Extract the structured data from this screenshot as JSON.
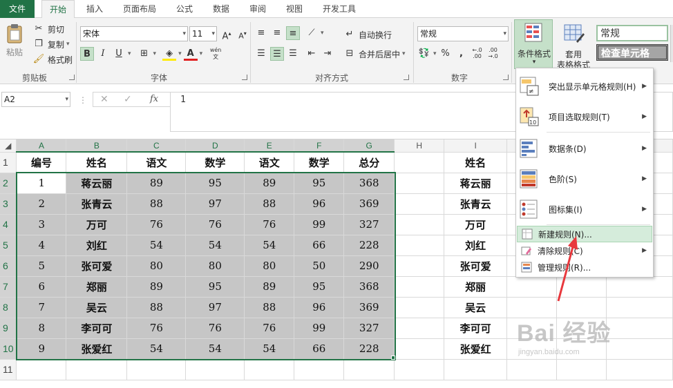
{
  "tabs": [
    "文件",
    "开始",
    "插入",
    "页面布局",
    "公式",
    "数据",
    "审阅",
    "视图",
    "开发工具"
  ],
  "ribbon": {
    "clipboard": {
      "paste": "粘贴",
      "cut": "剪切",
      "copy": "复制",
      "format_painter": "格式刷",
      "group": "剪贴板"
    },
    "font": {
      "name": "宋体",
      "size": "11",
      "bold": "B",
      "italic": "I",
      "underline": "U",
      "phonetic": "wén",
      "group": "字体"
    },
    "alignment": {
      "wrap": "自动换行",
      "merge": "合并后居中",
      "group": "对齐方式"
    },
    "number": {
      "format": "常规",
      "percent": "%",
      "comma": ",",
      "group": "数字"
    },
    "styles": {
      "conditional": "条件格式",
      "table_format_1": "套用",
      "table_format_2": "表格格式",
      "style_normal": "常规",
      "style_check": "检查单元格"
    }
  },
  "formula_bar": {
    "name_box": "A2",
    "fx": "fx",
    "content": "1"
  },
  "columns": [
    "A",
    "B",
    "C",
    "D",
    "E",
    "F",
    "G",
    "H",
    "I"
  ],
  "rows": [
    {
      "n": "1",
      "cells": [
        "编号",
        "姓名",
        "语文",
        "数学",
        "语文",
        "数学",
        "总分",
        "",
        "姓名"
      ]
    },
    {
      "n": "2",
      "cells": [
        "1",
        "蒋云丽",
        "89",
        "95",
        "89",
        "95",
        "368",
        "",
        "蒋云丽"
      ]
    },
    {
      "n": "3",
      "cells": [
        "2",
        "张青云",
        "88",
        "97",
        "88",
        "96",
        "369",
        "",
        "张青云"
      ]
    },
    {
      "n": "4",
      "cells": [
        "3",
        "万可",
        "76",
        "76",
        "76",
        "99",
        "327",
        "",
        "万可"
      ]
    },
    {
      "n": "5",
      "cells": [
        "4",
        "刘红",
        "54",
        "54",
        "54",
        "66",
        "228",
        "",
        "刘红"
      ]
    },
    {
      "n": "6",
      "cells": [
        "5",
        "张可爱",
        "80",
        "80",
        "80",
        "50",
        "290",
        "",
        "张可爱"
      ]
    },
    {
      "n": "7",
      "cells": [
        "6",
        "郑丽",
        "89",
        "95",
        "89",
        "95",
        "368",
        "",
        "郑丽"
      ]
    },
    {
      "n": "8",
      "cells": [
        "7",
        "吴云",
        "88",
        "97",
        "88",
        "96",
        "369",
        "",
        "吴云"
      ]
    },
    {
      "n": "9",
      "cells": [
        "8",
        "李可可",
        "76",
        "76",
        "76",
        "99",
        "327",
        "",
        "李可可"
      ]
    },
    {
      "n": "10",
      "cells": [
        "9",
        "张爱红",
        "54",
        "54",
        "54",
        "66",
        "228",
        "",
        "张爱红"
      ]
    },
    {
      "n": "11",
      "cells": [
        "",
        "",
        "",
        "",
        "",
        "",
        "",
        "",
        ""
      ]
    }
  ],
  "menu": {
    "highlight": "突出显示单元格规则(H)",
    "topbottom": "项目选取规则(T)",
    "databar": "数据条(D)",
    "colorscale": "色阶(S)",
    "iconset": "图标集(I)",
    "new_rule": "新建规则(N)...",
    "clear_rules": "清除规则(C)",
    "manage_rules": "管理规则(R)..."
  },
  "watermark": {
    "brand": "Bai 经验",
    "url": "jingyan.baidu.com"
  },
  "colors": {
    "accent": "#217346",
    "selection": "#c6c6c6",
    "menu_highlight": "#d5ecdb",
    "annotation_arrow": "#e8383d"
  }
}
